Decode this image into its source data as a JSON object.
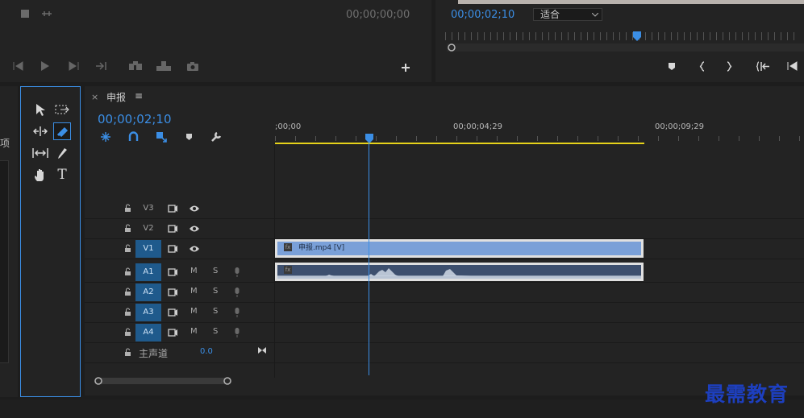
{
  "source_monitor": {
    "timecode": "00;00;00;00"
  },
  "program_monitor": {
    "timecode": "00;00;02;10",
    "fit_label": "适合"
  },
  "left_panel": {
    "label": "项"
  },
  "sequence": {
    "close": "×",
    "name": "申报",
    "menu": "≡",
    "timecode": "00;00;02;10",
    "ruler": [
      ";00;00",
      "00;00;04;29",
      "00;00;09;29"
    ],
    "clip_video": "申报.mp4 [V]",
    "fx": "fx"
  },
  "tracks": {
    "video": [
      {
        "id": "V3",
        "active": false
      },
      {
        "id": "V2",
        "active": false
      },
      {
        "id": "V1",
        "active": true
      }
    ],
    "audio": [
      {
        "id": "A1",
        "m": "M",
        "s": "S"
      },
      {
        "id": "A2",
        "m": "M",
        "s": "S"
      },
      {
        "id": "A3",
        "m": "M",
        "s": "S"
      },
      {
        "id": "A4",
        "m": "M",
        "s": "S"
      }
    ],
    "master": {
      "label": "主声道",
      "value": "0.0"
    }
  },
  "watermark": "最需教育",
  "tool_text": "T",
  "colors": {
    "accent": "#3b8ee5",
    "clip_video": "#7aa0d8",
    "clip_audio": "#3d4f6e",
    "work_area": "#e6d21a"
  }
}
